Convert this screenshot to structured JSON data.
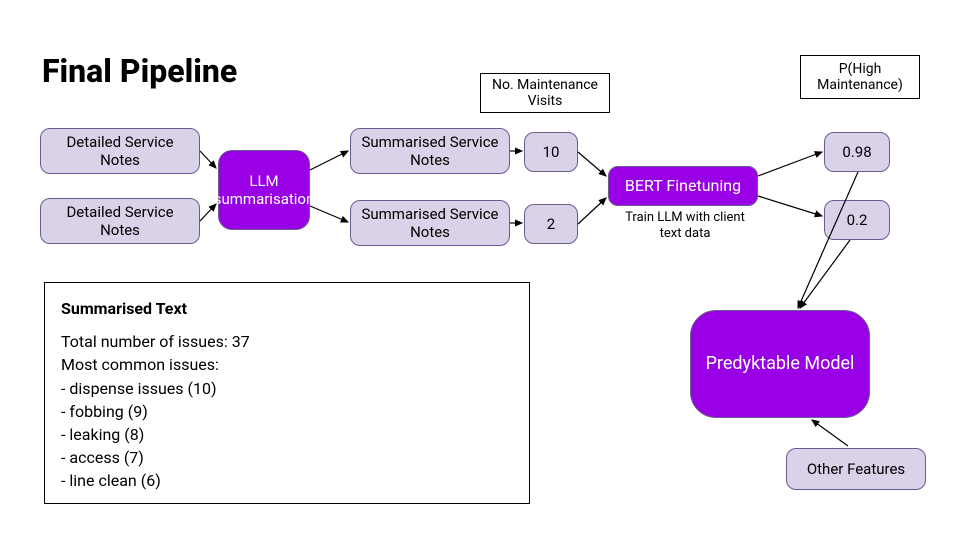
{
  "title": "Final Pipeline",
  "nodes": {
    "detailed1": "Detailed Service Notes",
    "detailed2": "Detailed Service Notes",
    "llm": "LLM summarisation",
    "summarised1": "Summarised Service Notes",
    "summarised2": "Summarised Service Notes",
    "count1": "10",
    "count2": "2",
    "bert": "BERT Finetuning",
    "prob1": "0.98",
    "prob2": "0.2",
    "predyktable": "Predyktable Model",
    "other": "Other Features"
  },
  "labels": {
    "maint_visits": "No. Maintenance Visits",
    "p_high": "P(High Maintenance)",
    "bert_caption": "Train LLM with client text data"
  },
  "summary": {
    "heading": "Summarised Text",
    "total_line": "Total number of issues: 37",
    "common_heading": "Most common issues:",
    "issues": [
      "- dispense issues (10)",
      "- fobbing (9)",
      "- leaking (8)",
      "- access (7)",
      "- line clean (6)"
    ]
  }
}
